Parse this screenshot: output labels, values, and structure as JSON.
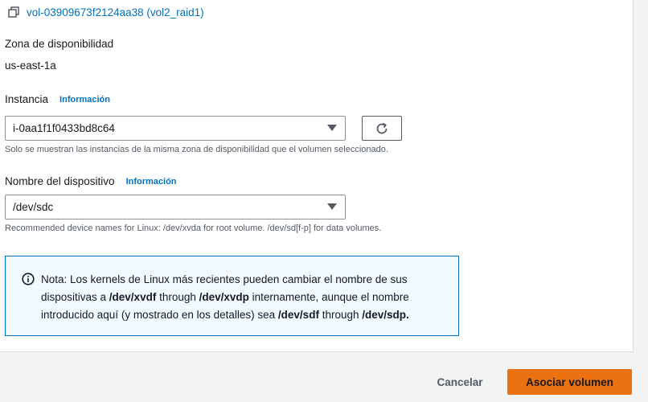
{
  "volume": {
    "link_text": "vol-03909673f2124aa38 (vol2_raid1)"
  },
  "availability_zone": {
    "label": "Zona de disponibilidad",
    "value": "us-east-1a"
  },
  "instance": {
    "label": "Instancia",
    "info_link": "Información",
    "selected": "i-0aa1f1f0433bd8c64",
    "hint": "Solo se muestran las instancias de la misma zona de disponibilidad que el volumen seleccionado."
  },
  "device": {
    "label": "Nombre del dispositivo",
    "info_link": "Información",
    "selected": "/dev/sdc",
    "hint": "Recommended device names for Linux: /dev/xvda for root volume. /dev/sd[f-p] for data volumes."
  },
  "note": {
    "prefix": "Nota: Los kernels de Linux más recientes pueden cambiar el nombre de sus dispositivas a ",
    "dev1": "/dev/xvdf",
    "through1": " through ",
    "dev2": "/dev/xvdp",
    "middle": " internamente, aunque el nombre introducido aquí (y mostrado en los detalles) sea ",
    "dev3": "/dev/sdf",
    "through2": " through ",
    "dev4": "/dev/sdp.",
    "icon": "info-circle-icon"
  },
  "actions": {
    "cancel_label": "Cancelar",
    "submit_label": "Asociar volumen"
  },
  "colors": {
    "link": "#0073bb",
    "primary": "#ec7211",
    "alert_border": "#0073bb",
    "alert_bg": "#f1faff"
  }
}
